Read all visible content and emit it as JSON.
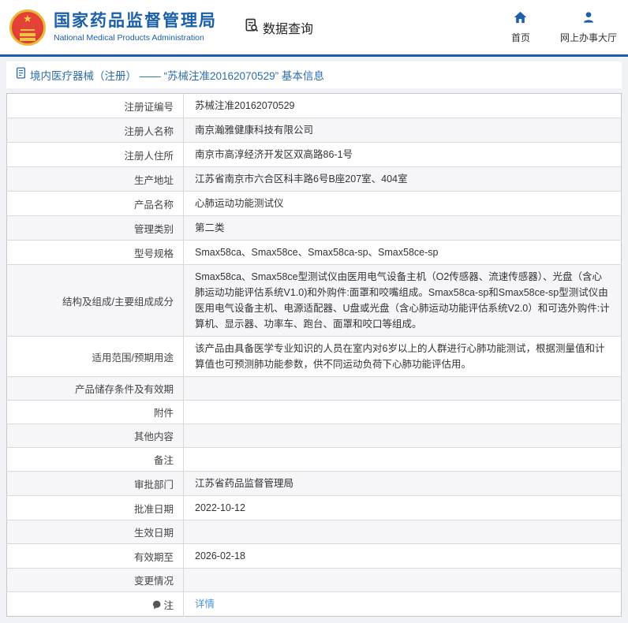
{
  "colors": {
    "brand_blue": "#1a5fa8",
    "header_line_blue": "#1b5fae",
    "link_blue": "#4a90d9",
    "breadcrumb_blue": "#2e6cad",
    "text_dark": "#333333",
    "row_alt_bg": "#f6f6f8",
    "page_bg": "#f1f2f5",
    "border_gray": "#c6c6c6",
    "emblem_red": "#d6392f",
    "emblem_gold": "#f0c545"
  },
  "header": {
    "org_name_cn": "国家药品监督管理局",
    "org_name_en": "National Medical Products Administration",
    "section_title": "数据查询",
    "nav": [
      {
        "label": "首页",
        "icon": "home-icon"
      },
      {
        "label": "网上办事大厅",
        "icon": "user-icon"
      }
    ]
  },
  "breadcrumb": {
    "icon": "document-icon",
    "text": "境内医疗器械（注册） ——  “苏械注准20162070529” 基本信息"
  },
  "table": {
    "rows": [
      {
        "label": "注册证编号",
        "value": "苏械注准20162070529"
      },
      {
        "label": "注册人名称",
        "value": "南京瀚雅健康科技有限公司"
      },
      {
        "label": "注册人住所",
        "value": "南京市高淳经济开发区双高路86-1号"
      },
      {
        "label": "生产地址",
        "value": "江苏省南京市六合区科丰路6号B座207室、404室"
      },
      {
        "label": "产品名称",
        "value": "心肺运动功能测试仪"
      },
      {
        "label": "管理类别",
        "value": "第二类"
      },
      {
        "label": "型号规格",
        "value": "Smax58ca、Smax58ce、Smax58ca-sp、Smax58ce-sp"
      },
      {
        "label": "结构及组成/主要组成成分",
        "value": "Smax58ca、Smax58ce型测试仪由医用电气设备主机（O2传感器、流速传感器）、光盘（含心肺运动功能评估系统V1.0)和外购件:面罩和咬嘴组成。Smax58ca-sp和Smax58ce-sp型测试仪由医用电气设备主机、电源适配器、U盘或光盘（含心肺运动功能评估系统V2.0）和可选外购件:计算机、显示器、功率车、跑台、面罩和咬口等组成。"
      },
      {
        "label": "适用范围/预期用途",
        "value": "该产品由具备医学专业知识的人员在室内对6岁以上的人群进行心肺功能测试，根据测量值和计算值也可预测肺功能参数，供不同运动负荷下心肺功能评估用。"
      },
      {
        "label": "产品储存条件及有效期",
        "value": ""
      },
      {
        "label": "附件",
        "value": ""
      },
      {
        "label": "其他内容",
        "value": ""
      },
      {
        "label": "备注",
        "value": ""
      },
      {
        "label": "审批部门",
        "value": "江苏省药品监督管理局"
      },
      {
        "label": "批准日期",
        "value": "2022-10-12"
      },
      {
        "label": "生效日期",
        "value": ""
      },
      {
        "label": "有效期至",
        "value": "2026-02-18"
      },
      {
        "label": "变更情况",
        "value": ""
      },
      {
        "label": "注",
        "value": "详情",
        "link": true,
        "note_icon": true
      }
    ]
  }
}
